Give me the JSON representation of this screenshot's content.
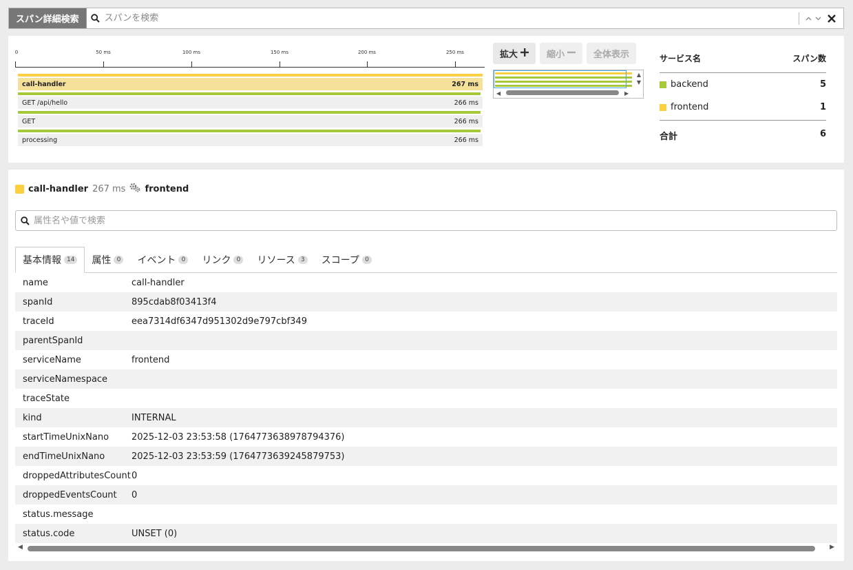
{
  "topbar": {
    "mode_label": "スパン詳細検索",
    "search_placeholder": "スパンを検索",
    "prev_icon": "chevron-up-icon",
    "next_icon": "chevron-down-icon",
    "close_icon": "close-icon"
  },
  "timeline": {
    "ticks": [
      "0",
      "50 ms",
      "100 ms",
      "150 ms",
      "200 ms",
      "250 ms"
    ],
    "tick_values_ms": [
      0,
      50,
      100,
      150,
      200,
      250
    ],
    "range_ms": 267,
    "spans": [
      {
        "name": "call-handler",
        "duration": "267 ms",
        "color": "#fbcf3f",
        "selected": true
      },
      {
        "name": "GET /api/hello",
        "duration": "266 ms",
        "color": "#a6c93a",
        "selected": false
      },
      {
        "name": "GET",
        "duration": "266 ms",
        "color": "#a6c93a",
        "selected": false
      },
      {
        "name": "processing",
        "duration": "266 ms",
        "color": "#a6c93a",
        "selected": false
      }
    ]
  },
  "zoom": {
    "zoom_in_label": "拡大",
    "zoom_out_label": "縮小",
    "fit_label": "全体表示"
  },
  "services": {
    "header_name": "サービス名",
    "header_count": "スパン数",
    "rows": [
      {
        "name": "backend",
        "count": "5",
        "color": "#a6c93a"
      },
      {
        "name": "frontend",
        "count": "1",
        "color": "#fbcf3f"
      }
    ],
    "total_label": "合計",
    "total_count": "6"
  },
  "detail": {
    "span_name": "call-handler",
    "duration": "267 ms",
    "service": "frontend",
    "service_icon": "gears-icon",
    "attr_search_placeholder": "属性名や値で検索",
    "tabs": [
      {
        "label": "基本情報",
        "count": "14"
      },
      {
        "label": "属性",
        "count": "0"
      },
      {
        "label": "イベント",
        "count": "0"
      },
      {
        "label": "リンク",
        "count": "0"
      },
      {
        "label": "リソース",
        "count": "3"
      },
      {
        "label": "スコープ",
        "count": "0"
      }
    ],
    "props": [
      {
        "k": "name",
        "v": "call-handler"
      },
      {
        "k": "spanId",
        "v": "895cdab8f03413f4"
      },
      {
        "k": "traceId",
        "v": "eea7314df6347d951302d9e797cbf349"
      },
      {
        "k": "parentSpanId",
        "v": ""
      },
      {
        "k": "serviceName",
        "v": "frontend"
      },
      {
        "k": "serviceNamespace",
        "v": ""
      },
      {
        "k": "traceState",
        "v": ""
      },
      {
        "k": "kind",
        "v": "INTERNAL"
      },
      {
        "k": "startTimeUnixNano",
        "v": "2025-12-03 23:53:58 (1764773638978794376)"
      },
      {
        "k": "endTimeUnixNano",
        "v": "2025-12-03 23:53:59 (1764773639245879753)"
      },
      {
        "k": "droppedAttributesCount",
        "v": "0"
      },
      {
        "k": "droppedEventsCount",
        "v": "0"
      },
      {
        "k": "status.message",
        "v": ""
      },
      {
        "k": "status.code",
        "v": "UNSET (0)"
      }
    ]
  }
}
